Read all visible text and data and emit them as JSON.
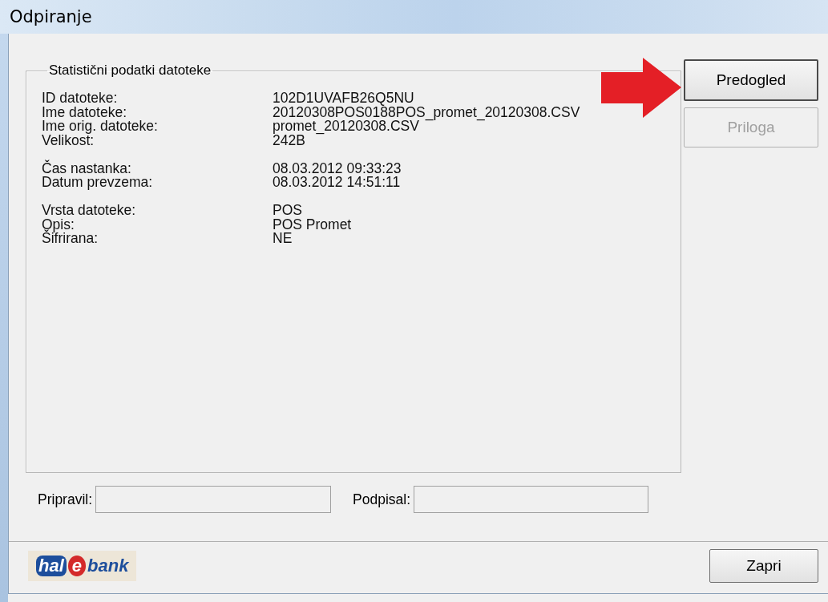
{
  "window": {
    "title": "Odpiranje"
  },
  "group": {
    "title": "Statistični podatki datoteke",
    "sections": [
      [
        {
          "label": "ID datoteke:",
          "value": "102D1UVAFB26Q5NU"
        },
        {
          "label": "Ime datoteke:",
          "value": "20120308POS0188POS_promet_20120308.CSV"
        },
        {
          "label": "Ime orig. datoteke:",
          "value": "promet_20120308.CSV"
        },
        {
          "label": "Velikost:",
          "value": "242B"
        }
      ],
      [
        {
          "label": "Čas nastanka:",
          "value": "08.03.2012 09:33:23"
        },
        {
          "label": "Datum prevzema:",
          "value": "08.03.2012 14:51:11"
        }
      ],
      [
        {
          "label": "Vrsta datoteke:",
          "value": "POS"
        },
        {
          "label": "Opis:",
          "value": "POS Promet"
        },
        {
          "label": "Šifrirana:",
          "value": "NE"
        }
      ]
    ]
  },
  "fields": [
    {
      "label": "Pripravil:"
    },
    {
      "label": "Podpisal:"
    }
  ],
  "side_buttons": [
    {
      "label": "Predogled",
      "disabled": false
    },
    {
      "label": "Priloga",
      "disabled": true
    }
  ],
  "logo": {
    "parts": [
      "hal",
      "e",
      "bank"
    ]
  },
  "close_button": {
    "label": "Zapri"
  }
}
